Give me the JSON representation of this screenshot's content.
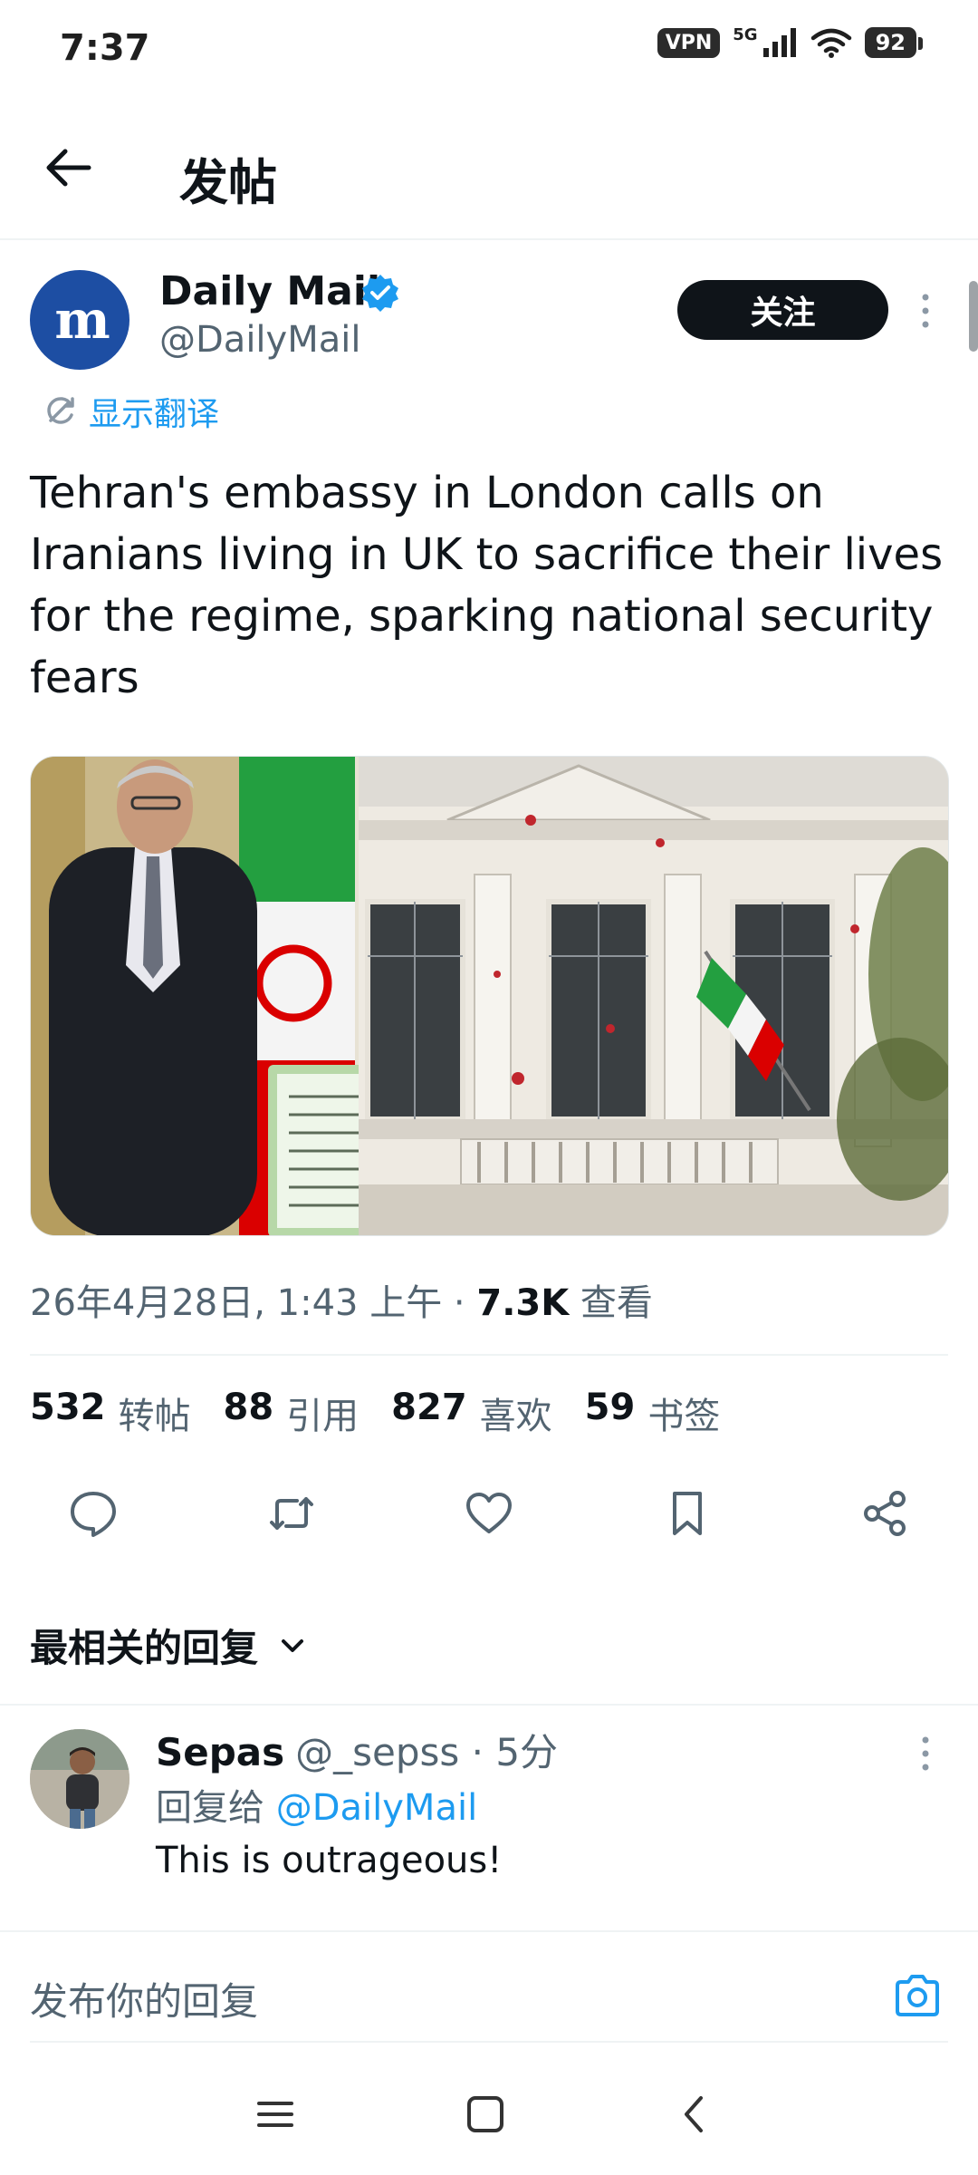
{
  "status_bar": {
    "time": "7:37",
    "vpn": "VPN",
    "network": "5G",
    "battery": "92"
  },
  "header": {
    "title": "发帖"
  },
  "post": {
    "author_name": "Daily Mail",
    "author_handle": "@DailyMail",
    "avatar_letter": "m",
    "follow_label": "关注",
    "translate_label": "显示翻译",
    "text": "Tehran's embassy in London calls on Iranians living in UK to sacrifice their lives for the regime, sparking national security fears",
    "timestamp": "26年4月28日, 1:43 上午 · ",
    "views_count": "7.3K",
    "views_label": " 查看",
    "stats": [
      {
        "num": "532",
        "label": "转帖"
      },
      {
        "num": "88",
        "label": "引用"
      },
      {
        "num": "827",
        "label": "喜欢"
      },
      {
        "num": "59",
        "label": "书签"
      }
    ],
    "actions": [
      "reply-icon",
      "repost-icon",
      "like-icon",
      "bookmark-icon",
      "share-icon"
    ]
  },
  "replies_sort": {
    "label": "最相关的回复"
  },
  "reply": {
    "name": "Sepas",
    "meta": "@_sepss · 5分",
    "reply_to_prefix": "回复给 ",
    "reply_to_handle": "@DailyMail",
    "text": "This is outrageous!"
  },
  "composer": {
    "placeholder": "发布你的回复"
  },
  "colors": {
    "accent": "#1d9bf0",
    "text": "#0f1419",
    "muted": "#536471",
    "divider": "#eff3f4"
  }
}
